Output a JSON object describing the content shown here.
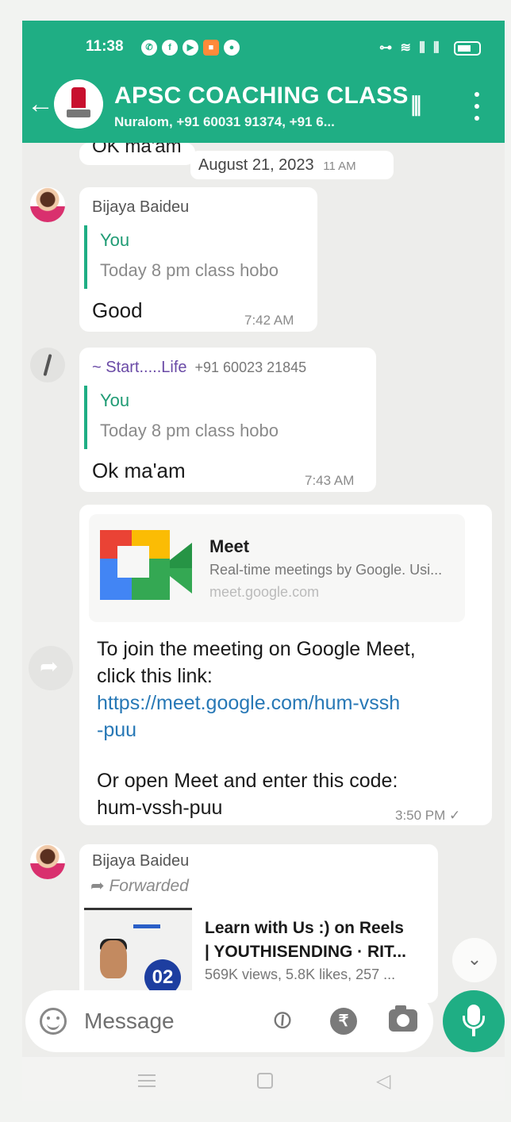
{
  "status_bar": {
    "time": "11:38",
    "right": "⊶ ≋ ⫼ ⫼"
  },
  "header": {
    "title": "APSC COACHING CLASS",
    "subtitle": "Nuralom, +91 60031 91374, +91 6..."
  },
  "chat": {
    "partial_text": "OK ma'am",
    "date_pill": "August 21, 2023",
    "date_pill_time": "11 AM",
    "messages": [
      {
        "sender": "Bijaya Baideu",
        "quote_name": "You",
        "quote_text": "Today 8 pm class hobo",
        "text": "Good",
        "time": "7:42 AM"
      },
      {
        "sender": "~ Start.....Life",
        "sender_phone": "+91 60023 21845",
        "quote_name": "You",
        "quote_text": "Today 8 pm class hobo",
        "text": "Ok ma'am",
        "time": "7:43 AM"
      }
    ],
    "meet_message": {
      "card_title": "Meet",
      "card_desc": "Real-time meetings by Google. Usi...",
      "card_url": "meet.google.com",
      "line1": "To join the meeting on Google Meet,",
      "line2": "click this link:",
      "link1": "https://meet.google.com/hum-vssh",
      "link2": "-puu",
      "line3": "Or open Meet and enter this code:",
      "line4": "hum-vssh-puu",
      "time": "3:50 PM ✓"
    },
    "forwarded_message": {
      "sender": "Bijaya Baideu",
      "forwarded_label": "Forwarded",
      "thumb_number": "02",
      "title1": "Learn with Us :) on Reels",
      "title2": "| YOUTHISENDING · RIT...",
      "meta": "569K views, 5.8K likes, 257 ..."
    }
  },
  "input": {
    "placeholder": "Message",
    "value": ""
  },
  "icons": {
    "back": "arrow-left",
    "wave": "audio-wave",
    "menu": "more-vertical",
    "emoji": "emoji",
    "attach": "paperclip",
    "payment": "rupee",
    "camera": "camera",
    "mic": "microphone",
    "scroll": "double-chevron-down"
  },
  "colors": {
    "brand": "#1fae84",
    "link": "#2778b6",
    "quote_name": "#1f9b74"
  }
}
